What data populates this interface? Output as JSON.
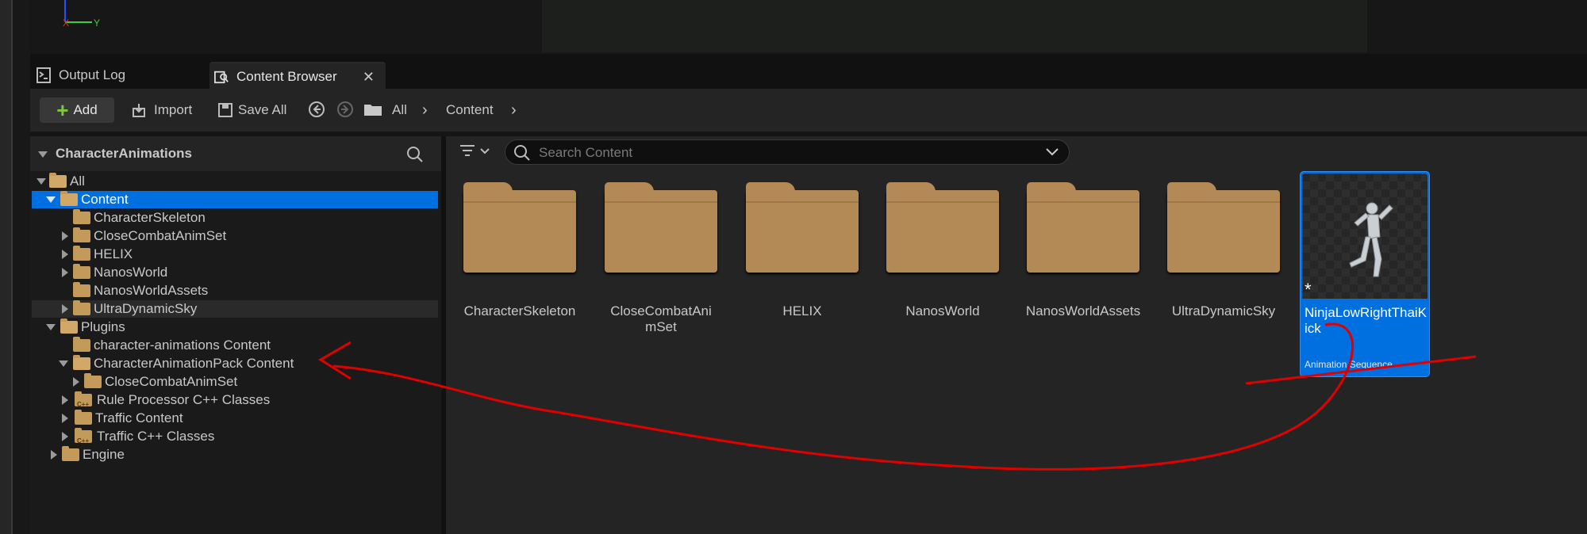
{
  "viewport": {
    "axis_labels": [
      "X",
      "Y"
    ]
  },
  "tabs": [
    {
      "label": "Output Log",
      "icon": "output-log-icon"
    },
    {
      "label": "Content Browser",
      "icon": "content-browser-icon",
      "active": true
    }
  ],
  "toolbar": {
    "add_label": "Add",
    "import_label": "Import",
    "save_all_label": "Save All",
    "breadcrumb": [
      "All",
      "Content"
    ]
  },
  "sources": {
    "title": "CharacterAnimations",
    "tree": [
      {
        "label": "All",
        "expanded": true
      },
      {
        "label": "Content",
        "expanded": true,
        "selected": true
      },
      {
        "label": "CharacterSkeleton"
      },
      {
        "label": "CloseCombatAnimSet"
      },
      {
        "label": "HELIX"
      },
      {
        "label": "NanosWorld"
      },
      {
        "label": "NanosWorldAssets"
      },
      {
        "label": "UltraDynamicSky"
      },
      {
        "label": "Plugins",
        "expanded": true
      },
      {
        "label": "character-animations Content"
      },
      {
        "label": "CharacterAnimationPack Content",
        "expanded": true
      },
      {
        "label": "CloseCombatAnimSet"
      },
      {
        "label": "Rule Processor C++ Classes"
      },
      {
        "label": "Traffic Content"
      },
      {
        "label": "Traffic C++ Classes"
      },
      {
        "label": "Engine"
      }
    ]
  },
  "search": {
    "placeholder": "Search Content"
  },
  "assets": {
    "folders": [
      "CharacterSkeleton",
      "CloseCombatAnimSet",
      "HELIX",
      "NanosWorld",
      "NanosWorldAssets",
      "UltraDynamicSky"
    ],
    "selected_asset": {
      "name": "NinjaLowRightThaiKick",
      "type": "Animation Sequence"
    }
  },
  "colors": {
    "selection": "#0070e0",
    "folder": "#b38a55",
    "annotation": "#e00000",
    "add_icon": "#7ec83c"
  }
}
